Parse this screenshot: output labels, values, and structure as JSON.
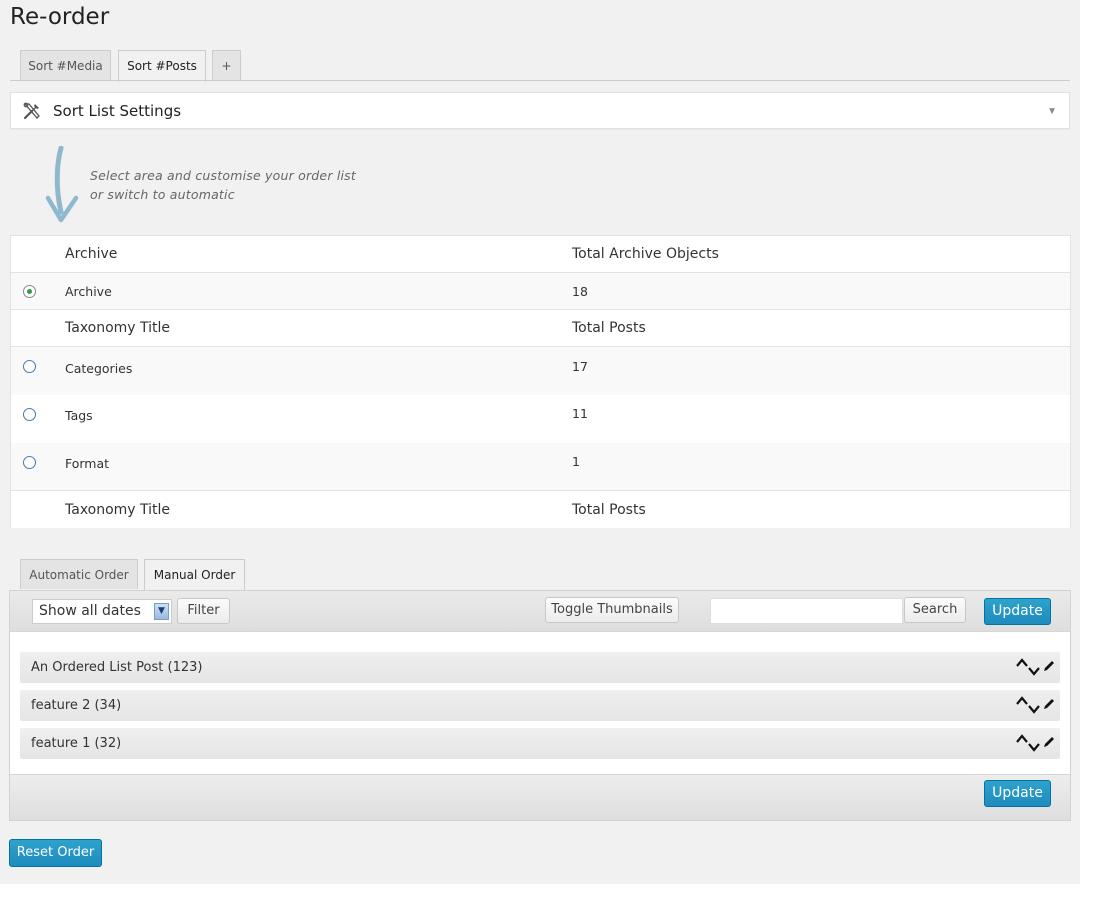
{
  "page": {
    "title": "Re-order"
  },
  "top_tabs": [
    {
      "label": "Sort #Media",
      "active": false
    },
    {
      "label": "Sort #Posts",
      "active": true
    },
    {
      "label": "+",
      "active": false
    }
  ],
  "settings": {
    "label": "Sort List Settings",
    "icon": "tools-icon",
    "toggle_icon": "triangle-down-icon"
  },
  "hint": {
    "line1": "Select area and customise your order list",
    "line2": "or switch to automatic"
  },
  "archive_table": {
    "headers": [
      "Archive",
      "Total Archive Objects"
    ],
    "rows": [
      {
        "label": "Archive",
        "count": "18",
        "selected": true
      }
    ]
  },
  "taxonomy_table": {
    "headers": [
      "Taxonomy Title",
      "Total Posts"
    ],
    "rows": [
      {
        "label": "Categories",
        "count": "17",
        "selected": false
      },
      {
        "label": "Tags",
        "count": "11",
        "selected": false
      },
      {
        "label": "Format",
        "count": "1",
        "selected": false
      }
    ],
    "footer": [
      "Taxonomy Title",
      "Total Posts"
    ]
  },
  "order_tabs": [
    {
      "label": "Automatic Order",
      "active": false
    },
    {
      "label": "Manual Order",
      "active": true
    }
  ],
  "toolbar": {
    "date_filter_value": "Show all dates",
    "filter_label": "Filter",
    "toggle_thumbnails_label": "Toggle Thumbnails",
    "search_value": "",
    "search_label": "Search",
    "update_label": "Update"
  },
  "items": [
    {
      "label": "An Ordered List Post (123)"
    },
    {
      "label": "feature 2 (34)"
    },
    {
      "label": "feature 1 (32)"
    }
  ],
  "footer": {
    "update_label": "Update"
  },
  "reset_label": "Reset Order",
  "colors": {
    "primary": "#2ea2cc",
    "radio_selected": "#2e9c4a",
    "hint_arrow": "#8fb8cf"
  }
}
